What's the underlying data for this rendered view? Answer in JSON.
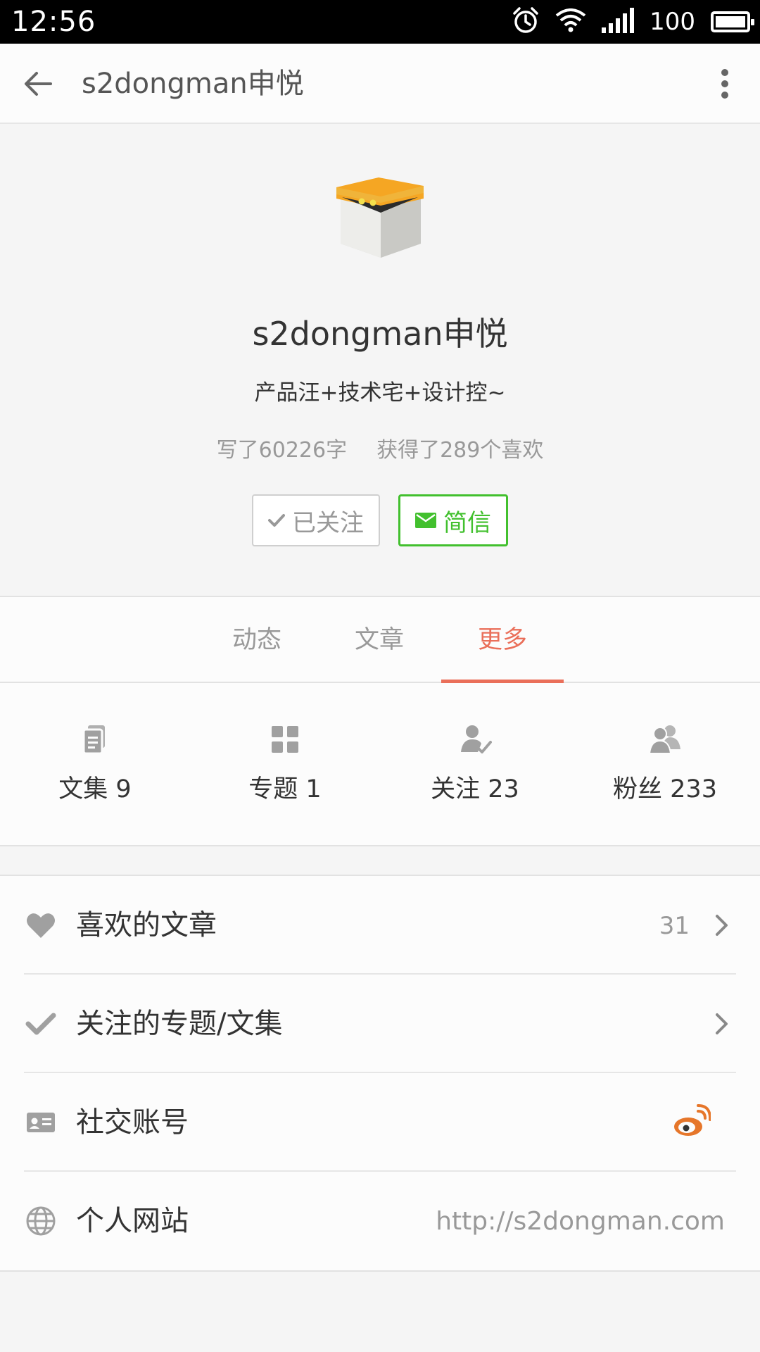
{
  "status_bar": {
    "time": "12:56",
    "battery_level": "100",
    "icons": [
      "alarm-icon",
      "wifi-icon",
      "signal-icon",
      "battery-icon"
    ]
  },
  "app_bar": {
    "title": "s2dongman申悦",
    "back_icon": "arrow-left-icon",
    "menu_icon": "more-vertical-icon"
  },
  "profile": {
    "name": "s2dongman申悦",
    "bio": "产品汪+技术宅+设计控~",
    "words_written": "写了60226字",
    "likes_received": "获得了289个喜欢",
    "follow_button": "已关注",
    "message_button": "简信"
  },
  "tabs": [
    {
      "label": "动态",
      "active": false
    },
    {
      "label": "文章",
      "active": false
    },
    {
      "label": "更多",
      "active": true
    }
  ],
  "counts": [
    {
      "label": "文集 9",
      "icon": "notebook-icon"
    },
    {
      "label": "专题 1",
      "icon": "grid-icon"
    },
    {
      "label": "关注 23",
      "icon": "user-check-icon"
    },
    {
      "label": "粉丝 233",
      "icon": "users-icon"
    }
  ],
  "list": [
    {
      "label": "喜欢的文章",
      "value": "31",
      "icon": "heart-icon"
    },
    {
      "label": "关注的专题/文集",
      "value": "",
      "icon": "check-icon"
    },
    {
      "label": "社交账号",
      "value": "",
      "icon": "id-card-icon",
      "trailing_icon": "weibo-icon"
    },
    {
      "label": "个人网站",
      "value": "http://s2dongman.com",
      "icon": "globe-icon"
    }
  ],
  "colors": {
    "accent_tab": "#ea6f5a",
    "message_green": "#42c02e",
    "weibo_orange": "#e6762a",
    "icon_gray": "#a0a0a0"
  }
}
